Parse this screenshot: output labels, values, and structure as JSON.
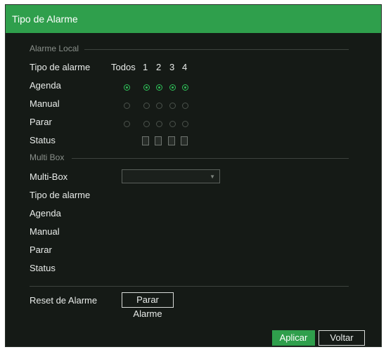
{
  "window": {
    "title": "Tipo de Alarme"
  },
  "local": {
    "section_title": "Alarme Local",
    "col_label": "Tipo de alarme",
    "col_todos": "Todos",
    "col_1": "1",
    "col_2": "2",
    "col_3": "3",
    "col_4": "4",
    "agenda_label": "Agenda",
    "manual_label": "Manual",
    "parar_label": "Parar",
    "status_label": "Status",
    "agenda_selected": true
  },
  "multibox": {
    "section_title": "Multi Box",
    "multibox_label": "Multi-Box",
    "multibox_value": "",
    "tipo_label": "Tipo de alarme",
    "agenda_label": "Agenda",
    "manual_label": "Manual",
    "parar_label": "Parar",
    "status_label": "Status"
  },
  "reset": {
    "label": "Reset de Alarme",
    "button_label": "Parar Alarme"
  },
  "footer": {
    "apply_label": "Aplicar",
    "back_label": "Voltar"
  },
  "colors": {
    "accent": "#2f9f4c",
    "background": "#151a16"
  }
}
